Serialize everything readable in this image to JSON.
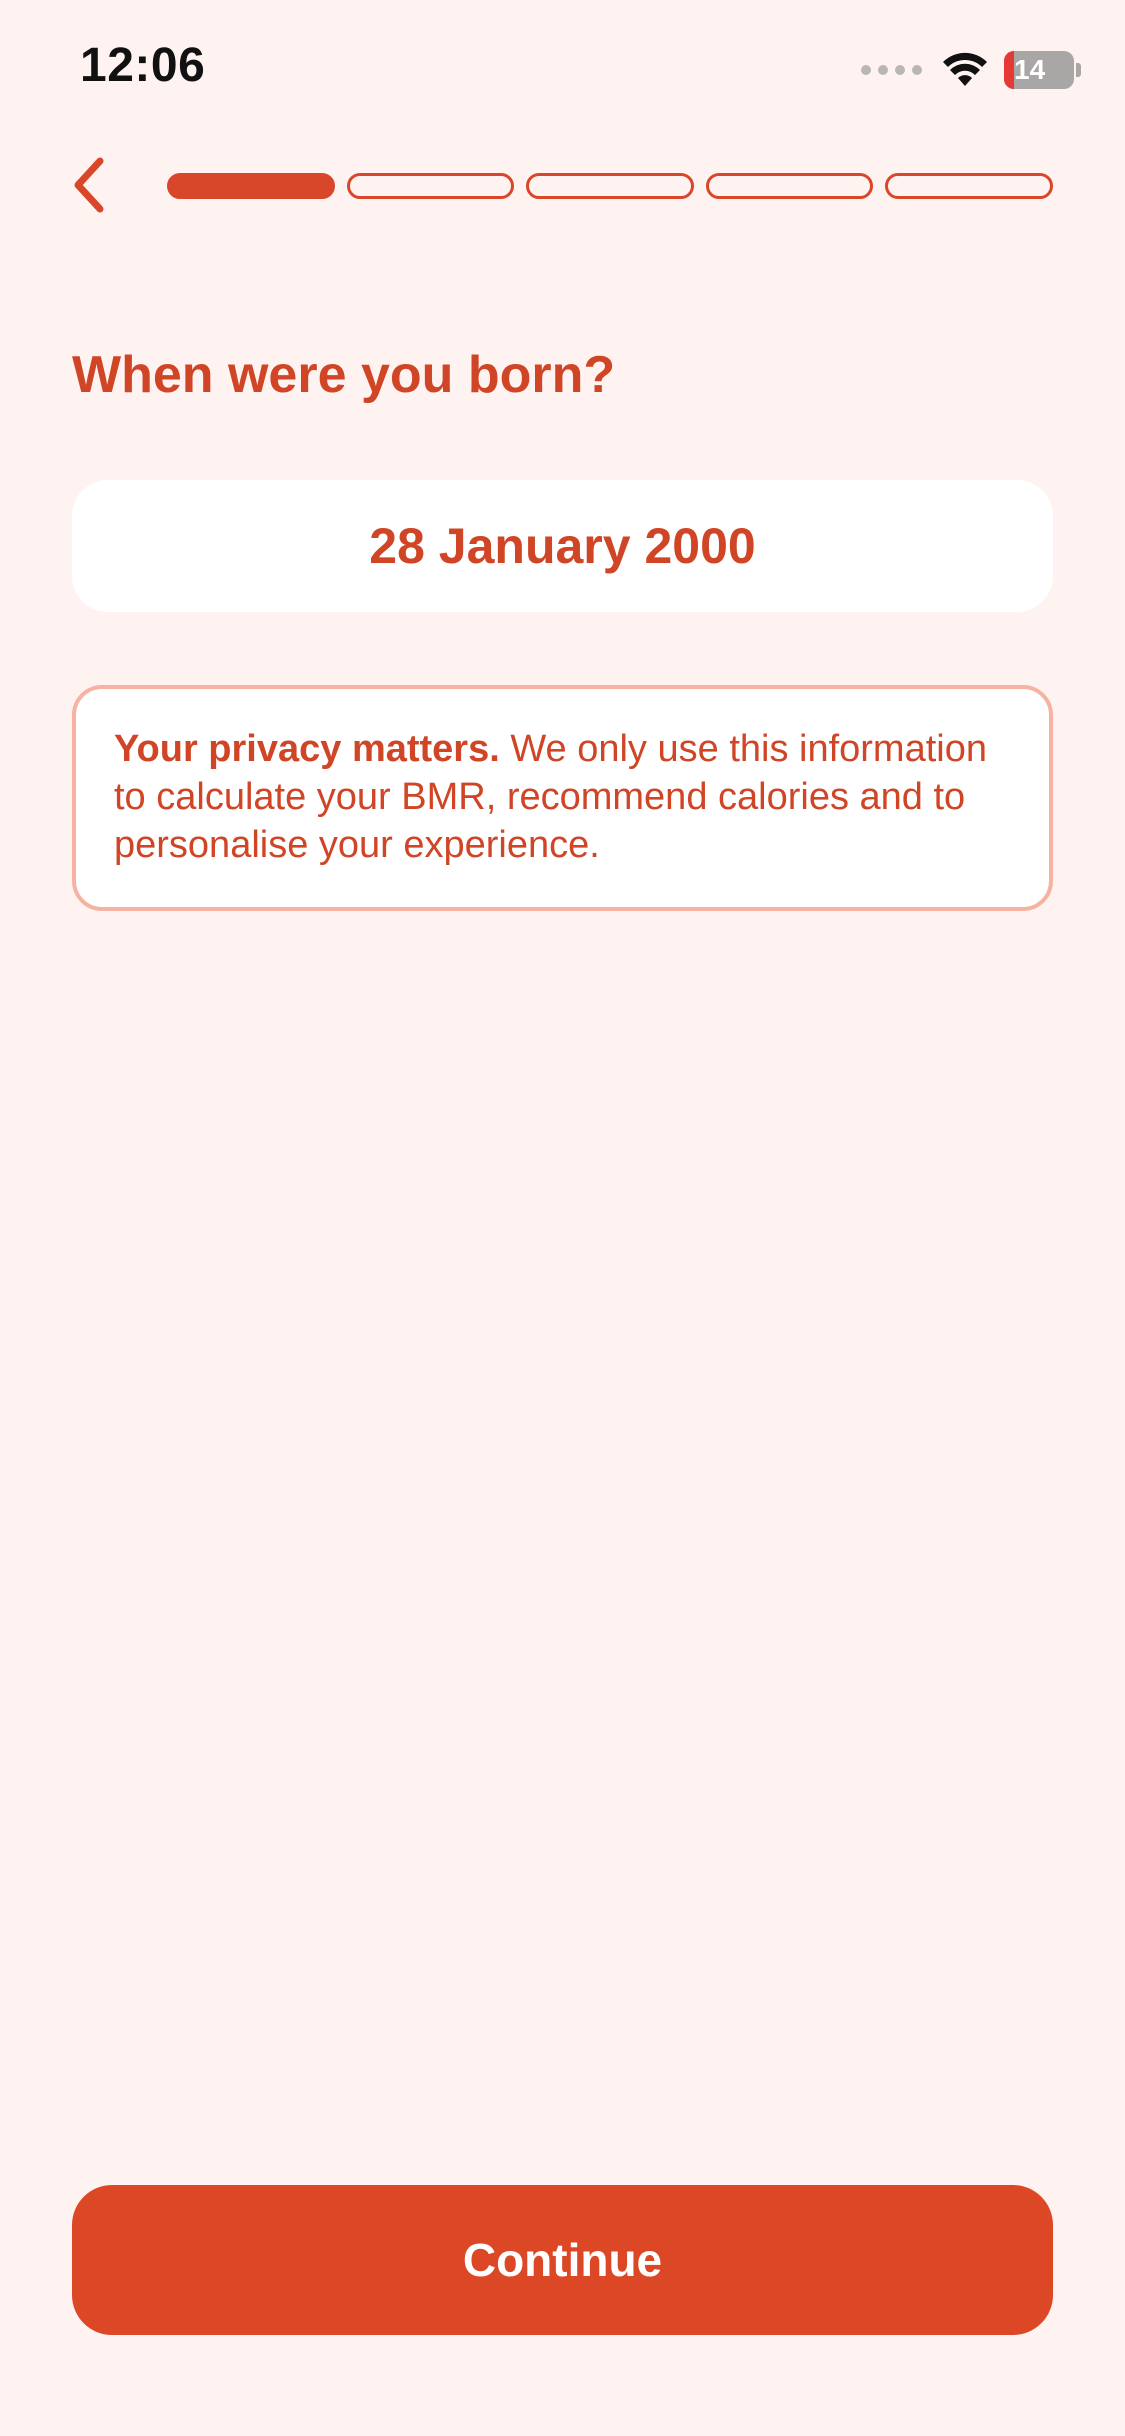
{
  "status_bar": {
    "time": "12:06",
    "battery_text": "14",
    "battery_level_percent": 14,
    "icons": [
      "signal-dots-icon",
      "wifi-icon",
      "battery-icon"
    ]
  },
  "nav": {
    "back_icon": "chevron-left-icon",
    "progress": {
      "total_steps": 5,
      "current_step": 1
    }
  },
  "question": {
    "title": "When were you born?"
  },
  "date_field": {
    "value": "28 January 2000"
  },
  "privacy": {
    "bold": "Your privacy matters.",
    "text": " We only use this information to calculate your BMR, recommend calories and to personalise your experience."
  },
  "footer": {
    "continue_label": "Continue"
  },
  "colors": {
    "accent": "#dc4826",
    "text_accent": "#cf4526",
    "background": "#fff3f1",
    "card_border": "#f6b2a2"
  }
}
